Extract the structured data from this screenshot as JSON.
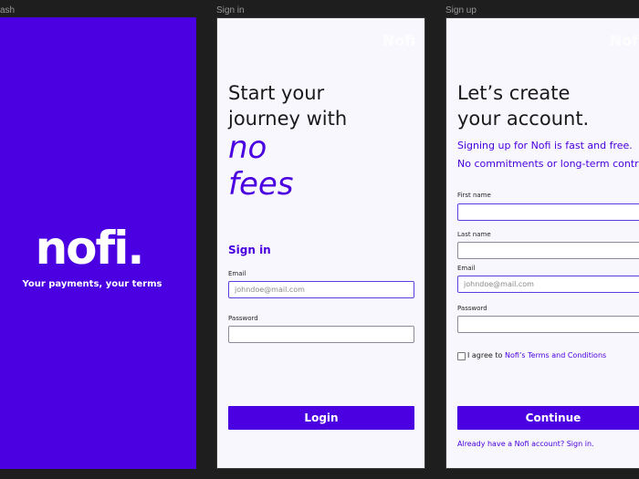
{
  "frames": {
    "splash_title": "ash",
    "signin_title": "Sign in",
    "signup_title": "Sign up"
  },
  "splash": {
    "logo": "nofi.",
    "tagline": "Your payments, your terms"
  },
  "signin": {
    "corner_brand": "Nofi",
    "headline_line1": "Start your",
    "headline_line2": "journey with",
    "accent_line1": "no",
    "accent_line2": "fees",
    "section_title": "Sign in",
    "email_label": "Email",
    "email_placeholder": "johndoe@mail.com",
    "password_label": "Password",
    "password_value": "",
    "login_label": "Login"
  },
  "signup": {
    "corner_brand": "Nofi",
    "headline_line1": "Let’s create",
    "headline_line2": "your account.",
    "sub1": "Signing up for Nofi is fast and free.",
    "sub2": "No commitments or long-term contracts.",
    "first_name_label": "First name",
    "last_name_label": "Last name",
    "email_label": "Email",
    "email_placeholder": "johndoe@mail.com",
    "password_label": "Password",
    "agree_prefix": "I agree to ",
    "agree_link": "Nofi’s Terms and Conditions",
    "continue_label": "Continue",
    "signin_link": "Already have a Nofi account? Sign in."
  },
  "colors": {
    "brand": "#4a00e0",
    "canvas": "#1e1e1e",
    "card": "#f8f7fd"
  }
}
